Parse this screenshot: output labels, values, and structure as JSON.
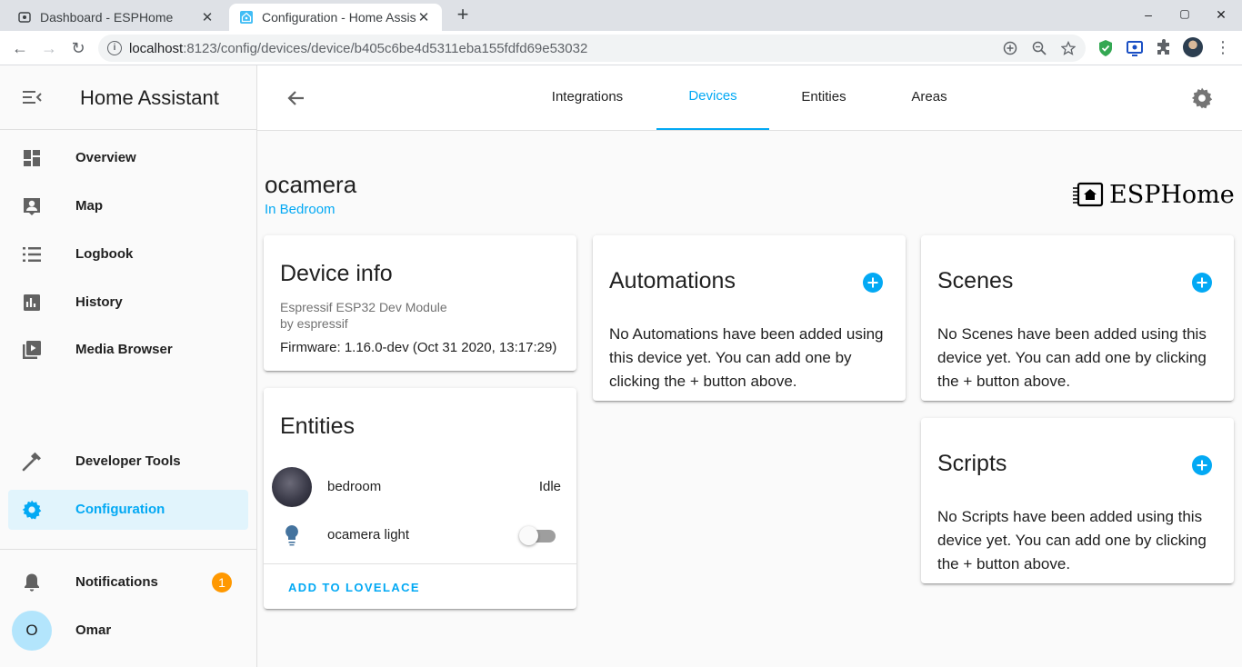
{
  "browser": {
    "tabs": [
      {
        "title": "Dashboard - ESPHome",
        "active": false
      },
      {
        "title": "Configuration - Home Assistant",
        "active": true
      }
    ],
    "url_host": "localhost",
    "url_rest": ":8123/config/devices/device/b405c6be4d5311eba155fdfd69e53032",
    "window_controls": {
      "minimize": "–",
      "maximize": "▢",
      "close": "✕"
    },
    "new_tab": "+"
  },
  "sidebar": {
    "title": "Home Assistant",
    "items": [
      {
        "label": "Overview",
        "icon": "view-dashboard-icon"
      },
      {
        "label": "Map",
        "icon": "account-box-icon"
      },
      {
        "label": "Logbook",
        "icon": "format-list-icon"
      },
      {
        "label": "History",
        "icon": "chart-box-icon"
      },
      {
        "label": "Media Browser",
        "icon": "play-box-multiple-icon"
      }
    ],
    "developer_tools": "Developer Tools",
    "configuration": "Configuration",
    "notifications": {
      "label": "Notifications",
      "count": "1"
    },
    "user": {
      "initial": "O",
      "name": "Omar"
    }
  },
  "header": {
    "tabs": [
      {
        "label": "Integrations",
        "active": false
      },
      {
        "label": "Devices",
        "active": true
      },
      {
        "label": "Entities",
        "active": false
      },
      {
        "label": "Areas",
        "active": false
      }
    ]
  },
  "device": {
    "name": "ocamera",
    "area": "In Bedroom",
    "brand": "ESPHome"
  },
  "device_info": {
    "title": "Device info",
    "model": "Espressif ESP32 Dev Module",
    "manufacturer": "by espressif",
    "firmware": "Firmware: 1.16.0-dev (Oct 31 2020, 13:17:29)"
  },
  "entities": {
    "title": "Entities",
    "rows": [
      {
        "name": "bedroom",
        "state": "Idle"
      },
      {
        "name": "ocamera light",
        "state": "off"
      }
    ],
    "action": "ADD TO LOVELACE"
  },
  "automations": {
    "title": "Automations",
    "text": "No Automations have been added using this device yet. You can add one by clicking the + button above."
  },
  "scenes": {
    "title": "Scenes",
    "text": "No Scenes have been added using this device yet. You can add one by clicking the + button above."
  },
  "scripts": {
    "title": "Scripts",
    "text": "No Scripts have been added using this device yet. You can add one by clicking the + button above."
  },
  "colors": {
    "accent": "#03a9f4",
    "badge": "#ff9800",
    "icon": "#5f6368",
    "text": "#212121"
  }
}
